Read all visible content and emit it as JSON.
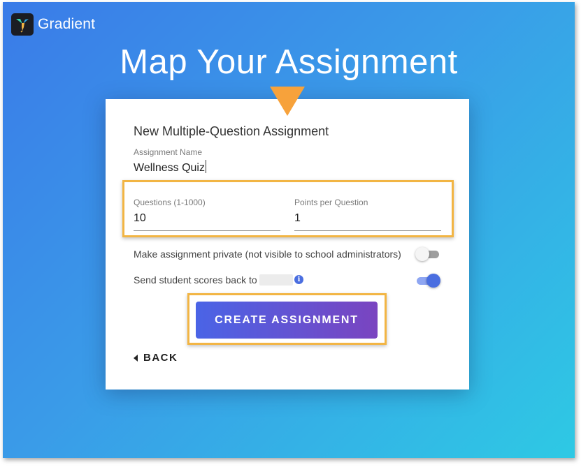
{
  "app": {
    "name": "Gradient"
  },
  "page": {
    "title": "Map Your Assignment"
  },
  "form": {
    "title": "New Multiple-Question Assignment",
    "assignment_name": {
      "label": "Assignment Name",
      "value": "Wellness Quiz"
    },
    "questions": {
      "label": "Questions (1-1000)",
      "value": "10"
    },
    "points": {
      "label": "Points per Question",
      "value": "1"
    },
    "private_toggle": {
      "label": "Make assignment private (not visible to school administrators)",
      "on": false
    },
    "send_scores": {
      "label": "Send student scores back to",
      "on": true
    },
    "info_glyph": "i",
    "create_label": "CREATE ASSIGNMENT",
    "back_label": "BACK"
  },
  "colors": {
    "highlight": "#f2b544",
    "pointer": "#f7a23b",
    "accent": "#4a6ee0",
    "button_start": "#4a64e6",
    "button_end": "#7a44c0"
  },
  "icons": [
    "hummingbird-logo-icon",
    "down-triangle-pointer-icon",
    "info-icon",
    "caret-left-icon"
  ]
}
